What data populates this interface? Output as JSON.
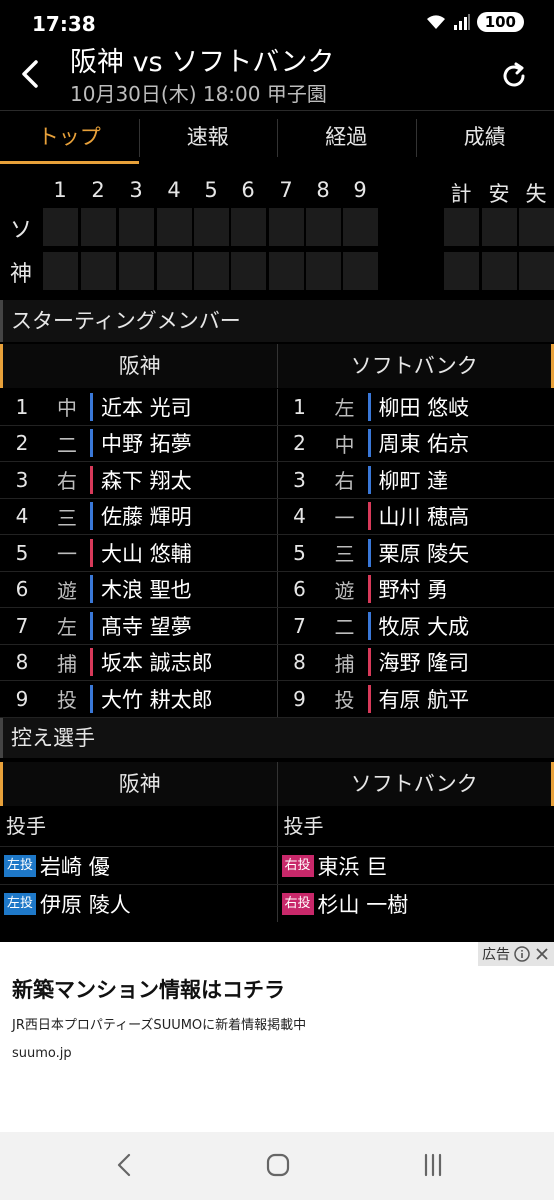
{
  "status": {
    "time": "17:38",
    "battery": "100"
  },
  "header": {
    "title": "阪神 vs ソフトバンク",
    "subtitle": "10月30日(木) 18:00 甲子園"
  },
  "tabs": [
    {
      "label": "トップ",
      "active": true
    },
    {
      "label": "速報",
      "active": false
    },
    {
      "label": "経過",
      "active": false
    },
    {
      "label": "成績",
      "active": false
    }
  ],
  "scoreboard": {
    "innings": [
      "1",
      "2",
      "3",
      "4",
      "5",
      "6",
      "7",
      "8",
      "9"
    ],
    "totals": [
      "計",
      "安",
      "失"
    ],
    "teams": [
      "ソ",
      "神"
    ]
  },
  "starting": {
    "title": "スターティングメンバー",
    "home_team": "阪神",
    "away_team": "ソフトバンク",
    "rows": [
      {
        "order": "1",
        "home_pos": "中",
        "home_name": "近本 光司",
        "away_pos": "左",
        "away_name": "柳田 悠岐"
      },
      {
        "order": "2",
        "home_pos": "二",
        "home_name": "中野 拓夢",
        "away_pos": "中",
        "away_name": "周東 佑京"
      },
      {
        "order": "3",
        "home_pos": "右",
        "home_name": "森下 翔太",
        "away_pos": "右",
        "away_name": "柳町 達"
      },
      {
        "order": "4",
        "home_pos": "三",
        "home_name": "佐藤 輝明",
        "away_pos": "一",
        "away_name": "山川 穂高"
      },
      {
        "order": "5",
        "home_pos": "一",
        "home_name": "大山 悠輔",
        "away_pos": "三",
        "away_name": "栗原 陵矢"
      },
      {
        "order": "6",
        "home_pos": "遊",
        "home_name": "木浪 聖也",
        "away_pos": "遊",
        "away_name": "野村 勇"
      },
      {
        "order": "7",
        "home_pos": "左",
        "home_name": "髙寺 望夢",
        "away_pos": "二",
        "away_name": "牧原 大成"
      },
      {
        "order": "8",
        "home_pos": "捕",
        "home_name": "坂本 誠志郎",
        "away_pos": "捕",
        "away_name": "海野 隆司"
      },
      {
        "order": "9",
        "home_pos": "投",
        "home_name": "大竹 耕太郎",
        "away_pos": "投",
        "away_name": "有原 航平"
      }
    ],
    "bat_colors": {
      "left": "#3a78d8",
      "right": "#d83a5a"
    },
    "home_bats": [
      "left",
      "left",
      "right",
      "left",
      "right",
      "left",
      "left",
      "right",
      "left"
    ],
    "away_bats": [
      "left",
      "left",
      "left",
      "right",
      "left",
      "right",
      "left",
      "right",
      "right"
    ]
  },
  "bench": {
    "title": "控え選手",
    "home_team": "阪神",
    "away_team": "ソフトバンク",
    "home_sub": "投手",
    "away_sub": "投手",
    "rows": [
      {
        "home_tag": "左投",
        "home_name": "岩崎 優",
        "away_tag": "右投",
        "away_name": "東浜 巨"
      },
      {
        "home_tag": "左投",
        "home_name": "伊原 陵人",
        "away_tag": "右投",
        "away_name": "杉山 一樹"
      }
    ]
  },
  "ad": {
    "label": "広告",
    "title": "新築マンション情報はコチラ",
    "desc": "JR西日本プロパティーズSUUMOに新着情報掲載中",
    "url": "suumo.jp"
  }
}
